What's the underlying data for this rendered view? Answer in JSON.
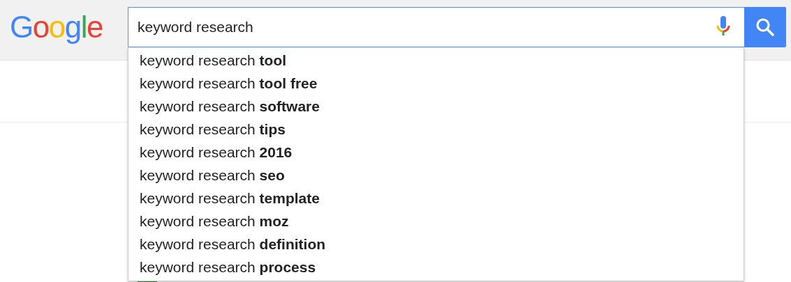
{
  "logo": {
    "text": "Google"
  },
  "search": {
    "value": "keyword research"
  },
  "suggestions": [
    "keyword research **tool**",
    "keyword research **tool free**",
    "keyword research **software**",
    "keyword research **tips**",
    "keyword research **2016**",
    "keyword research **seo**",
    "keyword research **template**",
    "keyword research **moz**",
    "keyword research **definition**",
    "keyword research **process**"
  ]
}
